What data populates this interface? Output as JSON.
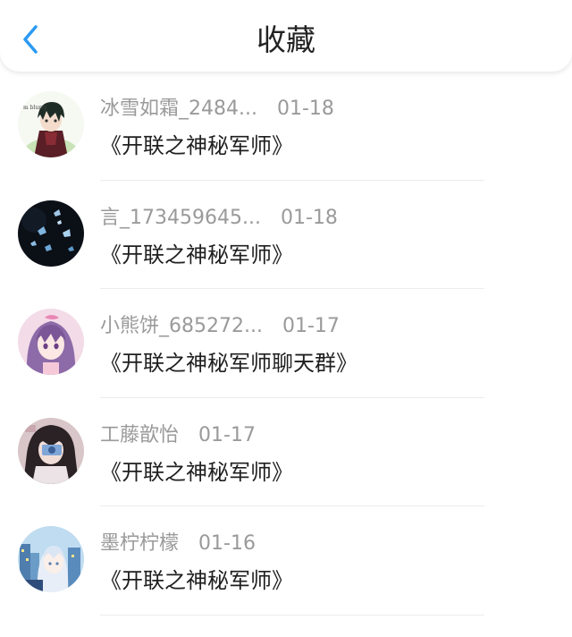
{
  "header": {
    "title": "收藏",
    "back_icon": "chevron-left-icon",
    "accent_color": "#2b9af3"
  },
  "items": [
    {
      "name": "冰雪如霜_2484...",
      "date": "01-18",
      "title": "《开联之神秘军师》",
      "avatar": "anime-boy-avatar"
    },
    {
      "name": "言_173459645...",
      "date": "01-18",
      "title": "《开联之神秘军师》",
      "avatar": "butterflies-avatar"
    },
    {
      "name": "小熊饼_685272...",
      "date": "01-17",
      "title": "《开联之神秘军师聊天群》",
      "avatar": "anime-girl-avatar"
    },
    {
      "name": "工藤歆怡",
      "date": "01-17",
      "title": "《开联之神秘军师》",
      "avatar": "girl-with-camera-avatar"
    },
    {
      "name": "墨柠柠檬",
      "date": "01-16",
      "title": "《开联之神秘军师》",
      "avatar": "anime-girl-city-avatar"
    }
  ]
}
